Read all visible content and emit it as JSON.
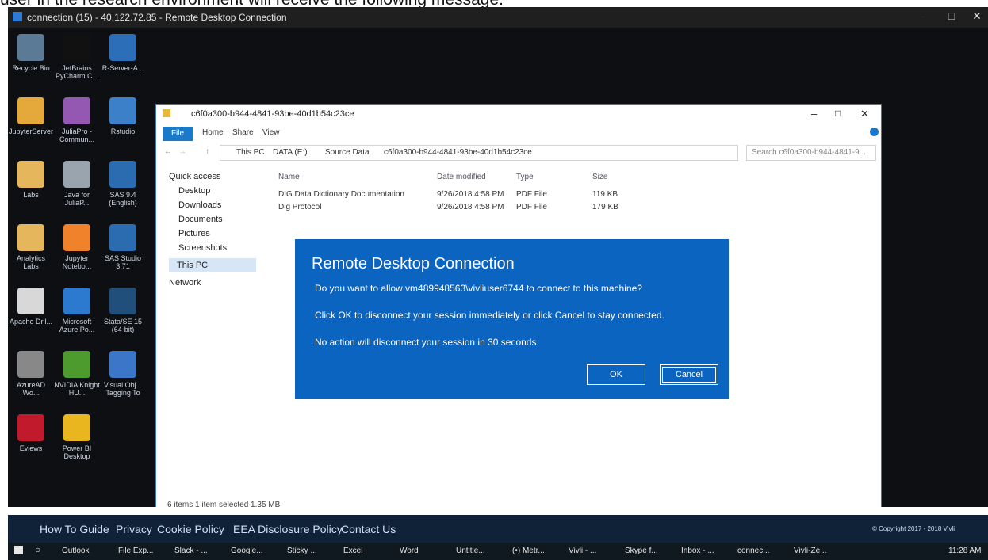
{
  "caption": "user in the research environment will receive the following message:",
  "rdp_window": {
    "title": "connection (15) - 40.122.72.85 - Remote Desktop Connection",
    "minimize": "–",
    "maximize": "□",
    "close": "✕"
  },
  "desktop_icons": [
    {
      "label": "Recycle Bin",
      "color": "#5a7a96"
    },
    {
      "label": "JetBrains PyCharm C...",
      "color": "#111111"
    },
    {
      "label": "R-Server-A...",
      "color": "#2c6fb8"
    },
    {
      "label": "JupyterServer",
      "color": "#e5a83b"
    },
    {
      "label": "JuliaPro - Commun...",
      "color": "#9558b2"
    },
    {
      "label": "Rstudio",
      "color": "#3b80c8"
    },
    {
      "label": "Labs",
      "color": "#e5b65c"
    },
    {
      "label": "Java for JuliaP...",
      "color": "#9aa4ae"
    },
    {
      "label": "SAS 9.4 (English)",
      "color": "#2b6cb0"
    },
    {
      "label": "Analytics Labs",
      "color": "#e5b65c"
    },
    {
      "label": "Jupyter Notebo...",
      "color": "#f0822c"
    },
    {
      "label": "SAS Studio 3.71",
      "color": "#2b6cb0"
    },
    {
      "label": "Apache Dril...",
      "color": "#d8d8d8"
    },
    {
      "label": "Microsoft Azure Po...",
      "color": "#2b7ad0"
    },
    {
      "label": "Stata/SE 15 (64-bit)",
      "color": "#1f4f7a"
    },
    {
      "label": "AzureAD Wo...",
      "color": "#888888"
    },
    {
      "label": "NVIDIA Knight HU...",
      "color": "#4d9a2f"
    },
    {
      "label": "Visual Obj... Tagging To",
      "color": "#3b76c8"
    },
    {
      "label": "Eviews",
      "color": "#c11a2d"
    },
    {
      "label": "Power BI Desktop",
      "color": "#e9b61f"
    }
  ],
  "explorer": {
    "title": "c6f0a300-b944-4841-93be-40d1b54c23ce",
    "tabs": [
      "File",
      "Home",
      "Share",
      "View"
    ],
    "breadcrumb": [
      "This PC",
      "DATA (E:)",
      "Source Data",
      "c6f0a300-b944-4841-93be-40d1b54c23ce"
    ],
    "search_placeholder": "Search c6f0a300-b944-4841-9...",
    "nav": [
      "Quick access",
      "Desktop",
      "Downloads",
      "Documents",
      "Pictures",
      "Screenshots",
      "This PC",
      "Network"
    ],
    "columns": [
      "Name",
      "Date modified",
      "Type",
      "Size"
    ],
    "files": [
      {
        "name": "DIG Data Dictionary Documentation",
        "date": "9/26/2018 4:58 PM",
        "type": "PDF File",
        "size": "119 KB"
      },
      {
        "name": "Dig Protocol",
        "date": "9/26/2018 4:58 PM",
        "type": "PDF File",
        "size": "179 KB"
      }
    ],
    "status": "6 items   1 item selected  1.35 MB"
  },
  "dialog": {
    "title": "Remote Desktop Connection",
    "line1": "Do you want to allow vm489948563\\vivliuser6744 to connect to this machine?",
    "line2": "Click OK to disconnect your session immediately or click Cancel to stay connected.",
    "line3": "No action will disconnect your session in 30 seconds.",
    "ok": "OK",
    "cancel": "Cancel"
  },
  "footer": {
    "links": [
      "How To Guide",
      "Privacy",
      "Cookie Policy",
      "EEA Disclosure Policy",
      "Contact Us"
    ],
    "copyright": "© Copyright 2017 - 2018 Vivli"
  },
  "taskbar": {
    "items": [
      "Outlook",
      "File Exp...",
      "Slack - ...",
      "Google...",
      "Sticky ...",
      "Excel",
      "Word",
      "Untitle...",
      "(•) Metr...",
      "Vivli - ...",
      "Skype f...",
      "Inbox - ...",
      "connec...",
      "Vivli-Ze..."
    ],
    "clock": "11:28 AM"
  }
}
